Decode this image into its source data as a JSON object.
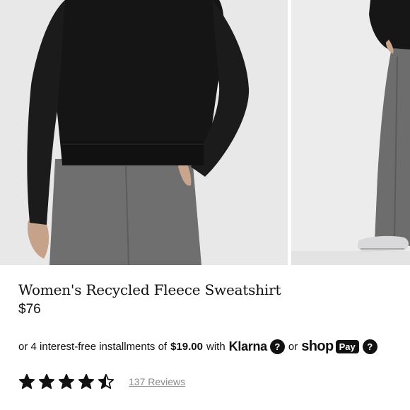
{
  "product": {
    "title": "Women's Recycled Fleece Sweatshirt",
    "price": "$76"
  },
  "installments": {
    "prefix": "or 4 interest-free installments of",
    "amount": "$19.00",
    "with_word": "with",
    "klarna_label": "Klarna",
    "help_symbol": "?",
    "or_word": "or",
    "shop_label": "shop",
    "pay_label": "Pay"
  },
  "rating": {
    "value": 4.5,
    "max": 5,
    "reviews_label": "137 Reviews"
  },
  "colors": {
    "text": "#111111",
    "muted": "#8a8a8a",
    "photo_bg": "#e9e9ea"
  },
  "gallery": {
    "images": [
      "product-photo-back-view",
      "product-photo-full-length"
    ]
  }
}
